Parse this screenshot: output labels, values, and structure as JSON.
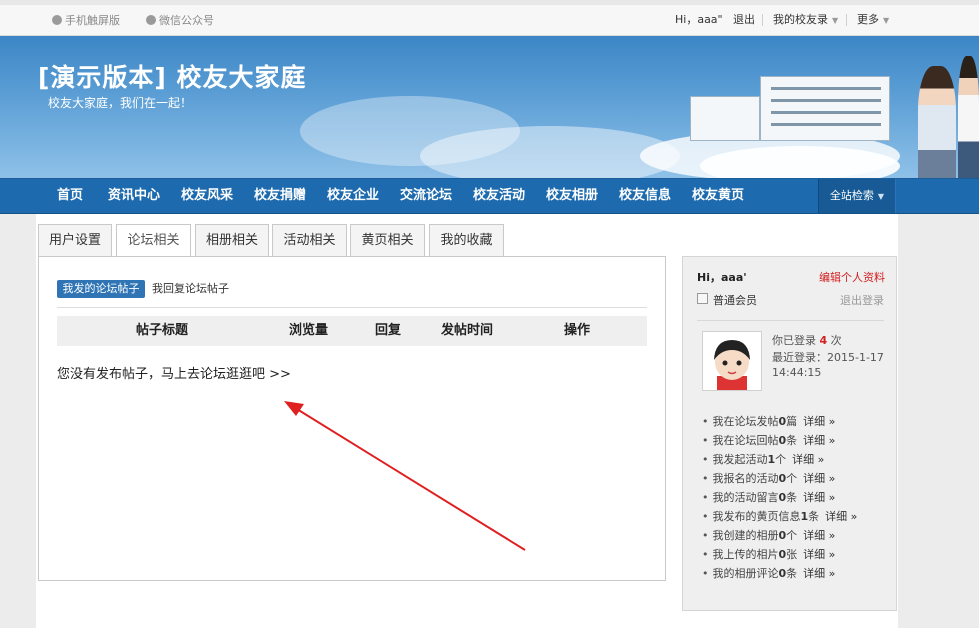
{
  "topbar": {
    "mobile_label": "手机触屏版",
    "wechat_label": "微信公众号",
    "greeting": "Hi，aaa\"",
    "logout": "退出",
    "my_alumni": "我的校友录",
    "more": "更多"
  },
  "banner": {
    "title": "[演示版本] 校友大家庭",
    "subtitle": "校友大家庭，我们在一起！"
  },
  "nav": {
    "items": [
      "首页",
      "资讯中心",
      "校友风采",
      "校友捐赠",
      "校友企业",
      "交流论坛",
      "校友活动",
      "校友相册",
      "校友信息",
      "校友黄页"
    ],
    "search": "全站检索"
  },
  "tabs": [
    "用户设置",
    "论坛相关",
    "相册相关",
    "活动相关",
    "黄页相关",
    "我的收藏"
  ],
  "active_tab": "论坛相关",
  "subtabs": {
    "active": "我发的论坛帖子",
    "other": "我回复论坛帖子"
  },
  "table": {
    "headers": [
      "帖子标题",
      "浏览量",
      "回复",
      "发帖时间",
      "操作"
    ],
    "empty_message": "您没有发布帖子，马上去论坛逛逛吧 >>"
  },
  "sidebar": {
    "greeting": "Hi，aaa'",
    "edit_profile": "编辑个人资料",
    "member_level": "普通会员",
    "logout": "退出登录",
    "login_prefix": "你已登录",
    "login_count": "4",
    "login_suffix": "次",
    "last_login_label": "最近登录：2015-1-17",
    "last_login_time": "14:44:15",
    "stats": [
      {
        "pre": "我在论坛发帖",
        "num": "0",
        "unit": "篇",
        "more": "详细 »"
      },
      {
        "pre": "我在论坛回帖",
        "num": "0",
        "unit": "条",
        "more": "详细 »"
      },
      {
        "pre": "我发起活动",
        "num": "1",
        "unit": "个",
        "more": "详细 »"
      },
      {
        "pre": "我报名的活动",
        "num": "0",
        "unit": "个",
        "more": "详细 »"
      },
      {
        "pre": "我的活动留言",
        "num": "0",
        "unit": "条",
        "more": "详细 »"
      },
      {
        "pre": "我发布的黄页信息",
        "num": "1",
        "unit": "条",
        "more": "详细 »"
      },
      {
        "pre": "我创建的相册",
        "num": "0",
        "unit": "个",
        "more": "详细 »"
      },
      {
        "pre": "我上传的相片",
        "num": "0",
        "unit": "张",
        "more": "详细 »"
      },
      {
        "pre": "我的相册评论",
        "num": "0",
        "unit": "条",
        "more": "详细 »"
      }
    ]
  },
  "colors": {
    "nav_bg": "#1d6aae",
    "accent_red": "#d21f1f",
    "active_subtab": "#2f74b4"
  }
}
